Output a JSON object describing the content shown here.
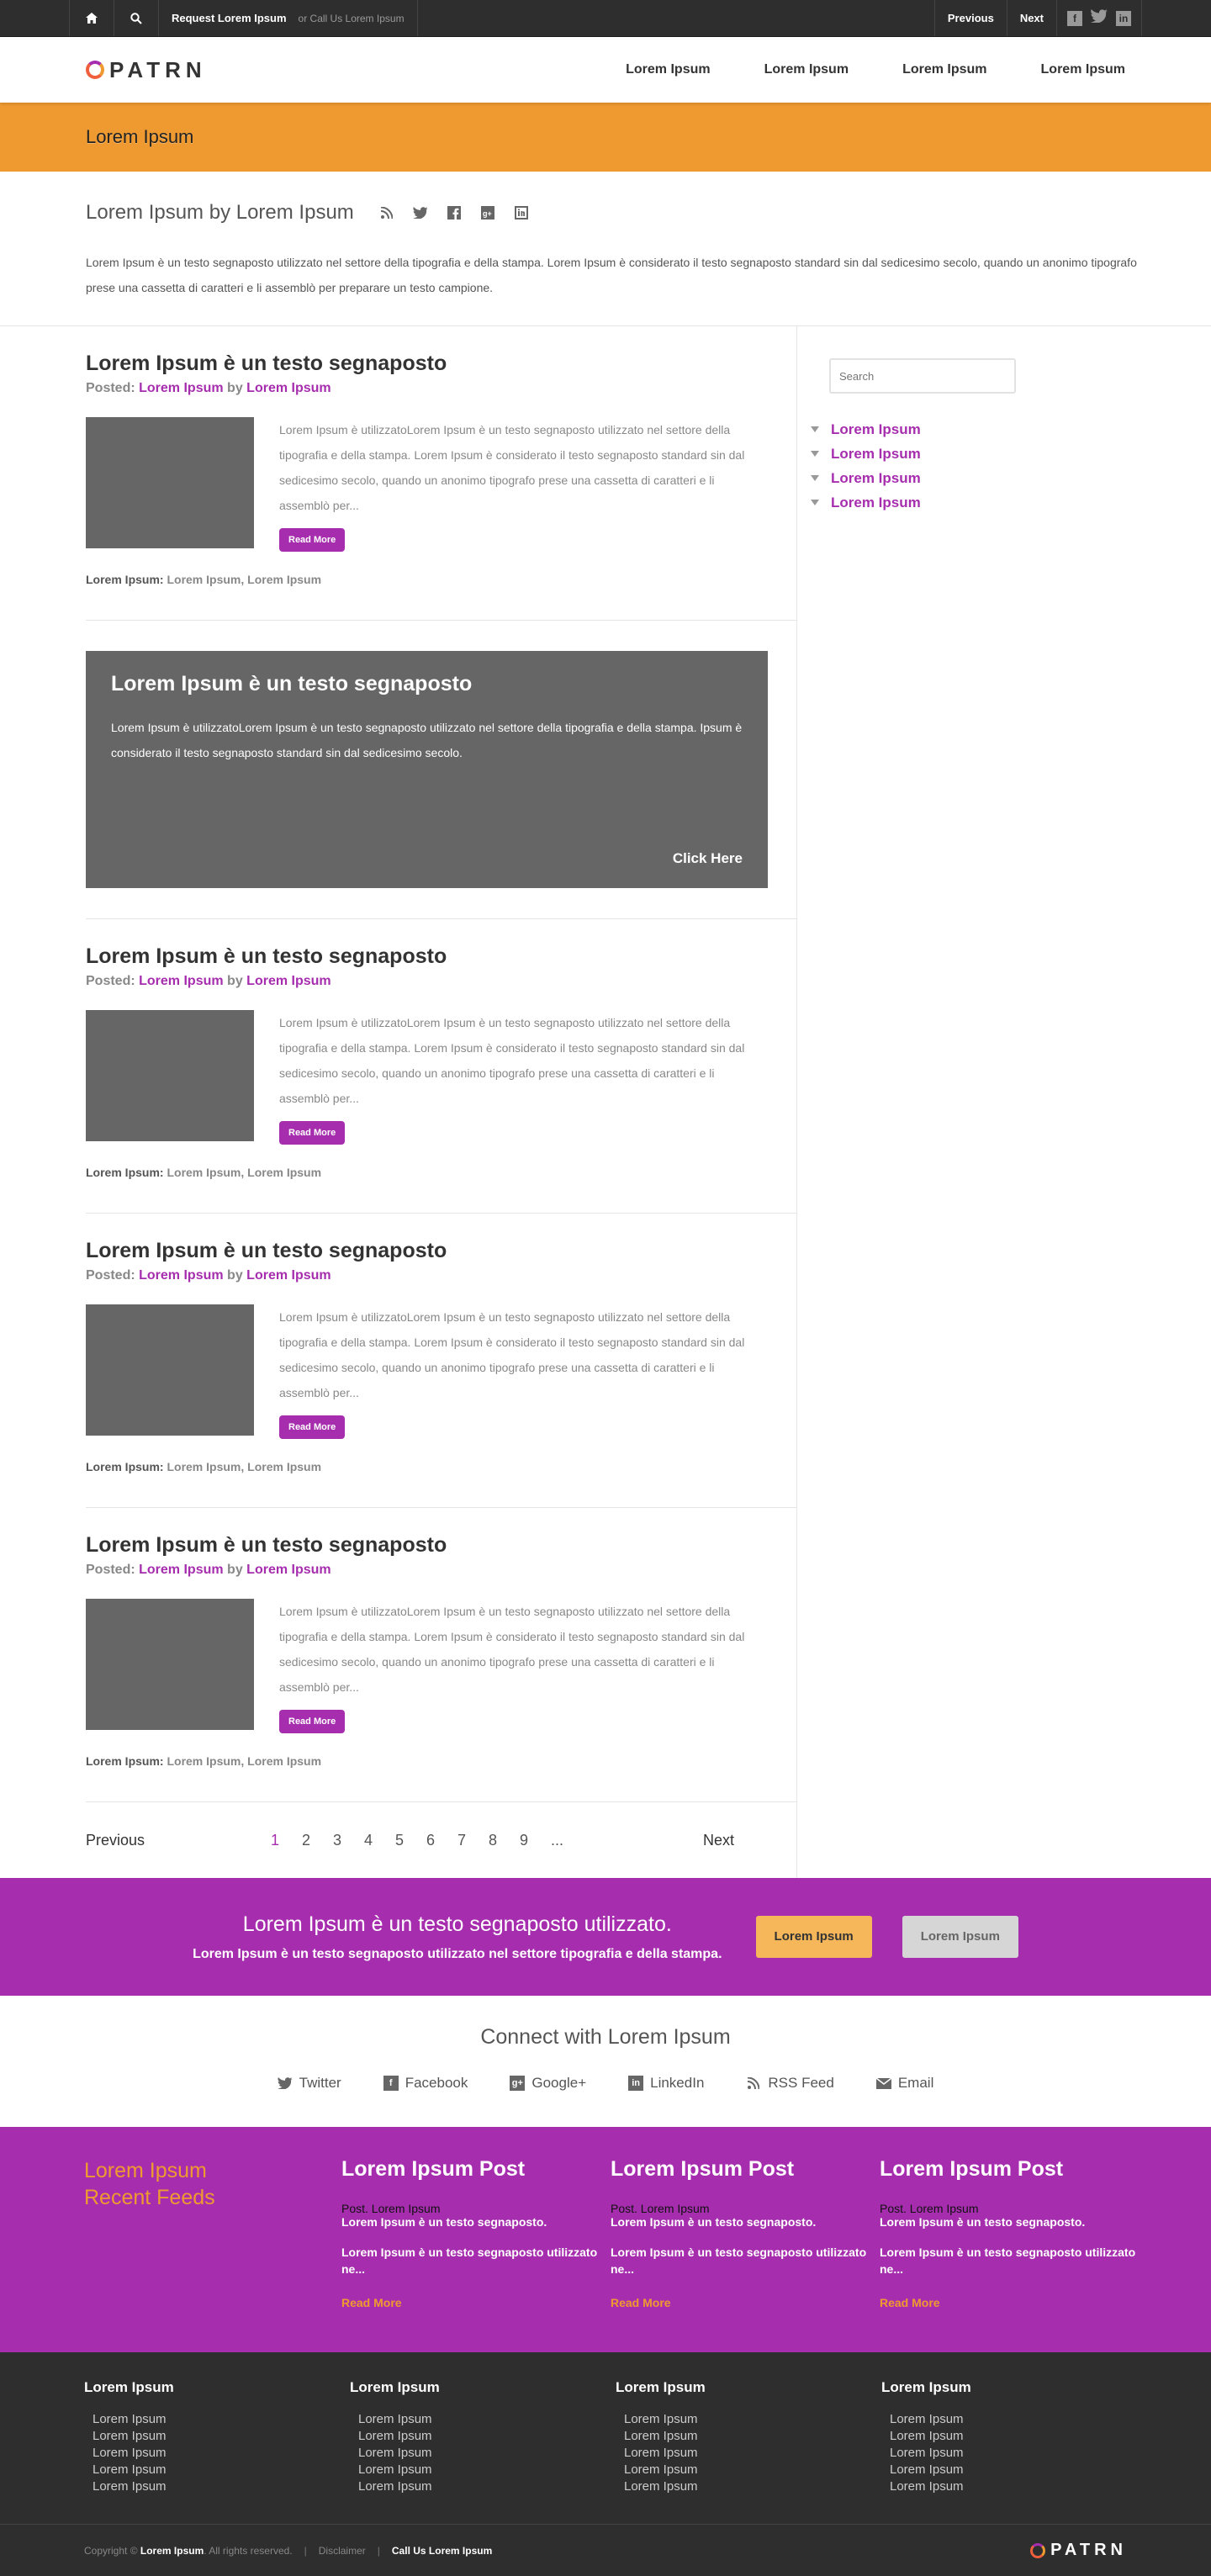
{
  "topbar": {
    "home_icon": "home-icon",
    "search_icon": "search-icon",
    "request": "Request Lorem Ipsum",
    "call": "or Call Us Lorem Ipsum",
    "previous": "Previous",
    "next": "Next",
    "social": [
      "f",
      "t",
      "in"
    ]
  },
  "header": {
    "logo": "PATRN",
    "nav": [
      "Lorem Ipsum",
      "Lorem Ipsum",
      "Lorem Ipsum",
      "Lorem Ipsum"
    ]
  },
  "banner": {
    "title": "Lorem Ipsum"
  },
  "intro": {
    "title": "Lorem Ipsum by Lorem Ipsum",
    "text": "Lorem Ipsum è un testo segnaposto utilizzato nel settore della tipografia e della stampa. Lorem Ipsum è considerato il testo segnaposto standard sin dal sedicesimo secolo, quando un anonimo tipografo prese una cassetta di caratteri e li assemblò per preparare un testo campione."
  },
  "posts": [
    {
      "title": "Lorem Ipsum è un testo segnaposto",
      "posted_label": "Posted:",
      "author": "Lorem Ipsum",
      "by": "by",
      "category": "Lorem Ipsum",
      "excerpt": "Lorem Ipsum è utilizzatoLorem Ipsum è un testo segnaposto utilizzato nel settore della tipografia e della stampa. Lorem Ipsum è considerato il testo segnaposto standard sin dal sedicesimo secolo, quando un anonimo tipografo prese una cassetta di caratteri e li assemblò per...",
      "read_more": "Read More",
      "tags_label": "Lorem Ipsum:",
      "tag1": "Lorem Ipsum",
      "tag2": "Lorem Ipsum"
    },
    {
      "title": "Lorem Ipsum è un testo segnaposto",
      "posted_label": "Posted:",
      "author": "Lorem Ipsum",
      "by": "by",
      "category": "Lorem Ipsum",
      "excerpt": "Lorem Ipsum è utilizzatoLorem Ipsum è un testo segnaposto utilizzato nel settore della tipografia e della stampa. Lorem Ipsum è considerato il testo segnaposto standard sin dal sedicesimo secolo, quando un anonimo tipografo prese una cassetta di caratteri e li assemblò per...",
      "read_more": "Read More",
      "tags_label": "Lorem Ipsum:",
      "tag1": "Lorem Ipsum",
      "tag2": "Lorem Ipsum"
    },
    {
      "title": "Lorem Ipsum è un testo segnaposto",
      "posted_label": "Posted:",
      "author": "Lorem Ipsum",
      "by": "by",
      "category": "Lorem Ipsum",
      "excerpt": "Lorem Ipsum è utilizzatoLorem Ipsum è un testo segnaposto utilizzato nel settore della tipografia e della stampa. Lorem Ipsum è considerato il testo segnaposto standard sin dal sedicesimo secolo, quando un anonimo tipografo prese una cassetta di caratteri e li assemblò per...",
      "read_more": "Read More",
      "tags_label": "Lorem Ipsum:",
      "tag1": "Lorem Ipsum",
      "tag2": "Lorem Ipsum"
    },
    {
      "title": "Lorem Ipsum è un testo segnaposto",
      "posted_label": "Posted:",
      "author": "Lorem Ipsum",
      "by": "by",
      "category": "Lorem Ipsum",
      "excerpt": "Lorem Ipsum è utilizzatoLorem Ipsum è un testo segnaposto utilizzato nel settore della tipografia e della stampa. Lorem Ipsum è considerato il testo segnaposto standard sin dal sedicesimo secolo, quando un anonimo tipografo prese una cassetta di caratteri e li assemblò per...",
      "read_more": "Read More",
      "tags_label": "Lorem Ipsum:",
      "tag1": "Lorem Ipsum",
      "tag2": "Lorem Ipsum"
    }
  ],
  "promo": {
    "title": "Lorem Ipsum è un testo segnaposto",
    "text": "Lorem Ipsum è utilizzatoLorem Ipsum è un testo segnaposto utilizzato nel settore della tipografia e della stampa. Ipsum è considerato il testo segnaposto standard sin dal sedicesimo secolo.",
    "cta": "Click Here"
  },
  "pager": {
    "previous": "Previous",
    "next": "Next",
    "pages": [
      "1",
      "2",
      "3",
      "4",
      "5",
      "6",
      "7",
      "8",
      "9",
      "..."
    ]
  },
  "sidebar": {
    "search_placeholder": "Search",
    "links": [
      "Lorem Ipsum",
      "Lorem Ipsum",
      "Lorem Ipsum",
      "Lorem Ipsum"
    ]
  },
  "cta": {
    "title": "Lorem Ipsum è un testo segnaposto utilizzato.",
    "text": "Lorem Ipsum è un testo segnaposto utilizzato nel settore tipografia e della stampa.",
    "btn1": "Lorem Ipsum",
    "btn2": "Lorem Ipsum"
  },
  "connect": {
    "title": "Connect with Lorem Ipsum",
    "links": [
      "Twitter",
      "Facebook",
      "Google+",
      "LinkedIn",
      "RSS Feed",
      "Email"
    ]
  },
  "feeds": {
    "title_line1": "Lorem Ipsum",
    "title_line2": "Recent Feeds",
    "items": [
      {
        "title": "Lorem Ipsum Post",
        "posted": "Post. Lorem Ipsum",
        "subtitle": "Lorem Ipsum è un testo segnaposto.",
        "excerpt": "Lorem Ipsum è un testo segnaposto utilizzato ne...",
        "read_more": "Read More"
      },
      {
        "title": "Lorem Ipsum Post",
        "posted": "Post. Lorem Ipsum",
        "subtitle": "Lorem Ipsum è un testo segnaposto.",
        "excerpt": "Lorem Ipsum è un testo segnaposto utilizzato ne...",
        "read_more": "Read More"
      },
      {
        "title": "Lorem Ipsum Post",
        "posted": "Post. Lorem Ipsum",
        "subtitle": "Lorem Ipsum è un testo segnaposto.",
        "excerpt": "Lorem Ipsum è un testo segnaposto utilizzato ne...",
        "read_more": "Read More"
      }
    ]
  },
  "footer": {
    "columns": [
      {
        "title": "Lorem Ipsum",
        "items": [
          "Lorem Ipsum",
          "Lorem Ipsum",
          "Lorem Ipsum",
          "Lorem Ipsum",
          "Lorem Ipsum"
        ]
      },
      {
        "title": "Lorem Ipsum",
        "items": [
          "Lorem Ipsum",
          "Lorem Ipsum",
          "Lorem Ipsum",
          "Lorem Ipsum",
          "Lorem Ipsum"
        ]
      },
      {
        "title": "Lorem Ipsum",
        "items": [
          "Lorem Ipsum",
          "Lorem Ipsum",
          "Lorem Ipsum",
          "Lorem Ipsum",
          "Lorem Ipsum"
        ]
      },
      {
        "title": "Lorem Ipsum",
        "items": [
          "Lorem Ipsum",
          "Lorem Ipsum",
          "Lorem Ipsum",
          "Lorem Ipsum",
          "Lorem Ipsum"
        ]
      }
    ],
    "copyright_prefix": "Copyright ©",
    "copyright_name": "Lorem Ipsum",
    "copyright_suffix": ". All rights reserved.",
    "disclaimer": "Disclaimer",
    "call": "Call Us Lorem Ipsum",
    "logo": "PATRN"
  },
  "colors": {
    "accent": "#a62eae",
    "orange": "#ef9a30",
    "dark": "#2e2e2e"
  }
}
